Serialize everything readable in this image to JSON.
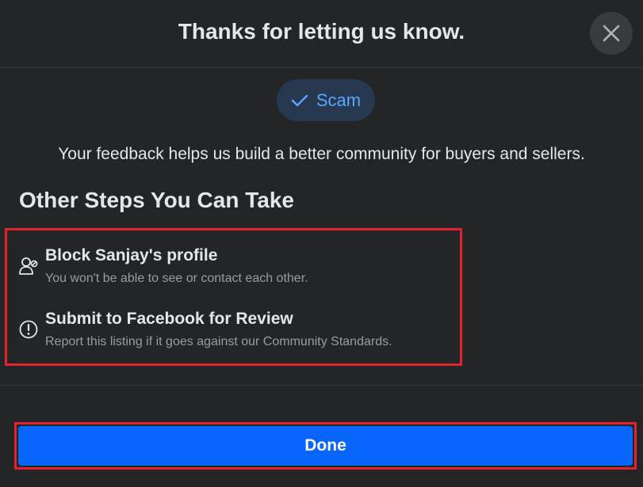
{
  "dialog": {
    "title": "Thanks for letting us know.",
    "close_icon": "close-icon"
  },
  "report": {
    "reason_label": "Scam",
    "reason_icon": "checkmark-icon",
    "feedback_text": "Your feedback helps us build a better community for buyers and sellers."
  },
  "steps": {
    "heading": "Other Steps You Can Take",
    "items": [
      {
        "title": "Block Sanjay's profile",
        "subtitle": "You won't be able to see or contact each other.",
        "icon": "block-user-icon"
      },
      {
        "title": "Submit to Facebook for Review",
        "subtitle": "Report this listing if it goes against our Community Standards.",
        "icon": "exclamation-circle-icon"
      }
    ]
  },
  "footer": {
    "done_label": "Done"
  },
  "colors": {
    "background": "#242526",
    "primary_text": "#e4e6eb",
    "secondary_text": "#9a9c9f",
    "accent": "#0866ff",
    "chip_bg": "#263951",
    "chip_text": "#5aa7ff",
    "highlight_border": "#e0232e"
  }
}
